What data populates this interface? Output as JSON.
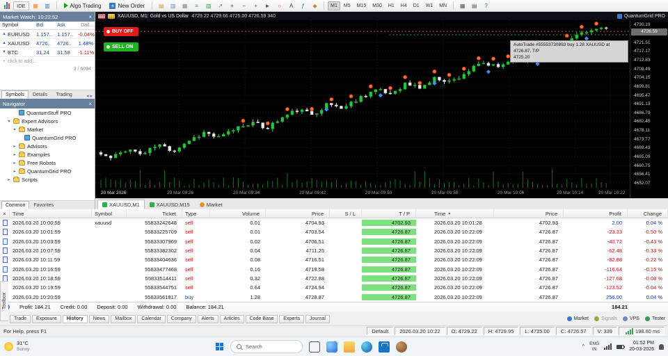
{
  "toolbar": {
    "ide": "IDE",
    "algo_trading": "Algo Trading",
    "new_order": "New Order",
    "timeframes": [
      "M1",
      "M5",
      "M15",
      "M30",
      "H1",
      "H4",
      "D1",
      "W1",
      "MN"
    ],
    "active_timeframe": "M1"
  },
  "market_watch": {
    "title": "Market Watch: 10:22:52",
    "columns": [
      "Symbol",
      "Bid",
      "Ask",
      "Dail..."
    ],
    "rows": [
      {
        "symbol": "EURUSD",
        "bid": "1.157..",
        "ask": "1.157..",
        "daily": "-0.04%",
        "dir": "up",
        "daily_color": "neg"
      },
      {
        "symbol": "XAUUSD",
        "bid": "4726..",
        "ask": "4726..",
        "daily": "1.48%",
        "dir": "up",
        "daily_color": "pos"
      },
      {
        "symbol": "BTC",
        "bid": "31.24",
        "ask": "31.58",
        "daily": "-1.11%",
        "dir": "down",
        "daily_color": "neg"
      }
    ],
    "add_hint": "click to add...",
    "count": "3 / 6094",
    "tabs": [
      "Symbols",
      "Details",
      "Trading"
    ],
    "active_tab": "Symbols"
  },
  "navigator": {
    "title": "Navigator",
    "tree": [
      {
        "label": "QuantumStuff PRO",
        "indent": 2,
        "icon": "ea",
        "arrow": ""
      },
      {
        "label": "Expert Advisors",
        "indent": 1,
        "icon": "folder",
        "arrow": "down"
      },
      {
        "label": "Market",
        "indent": 2,
        "icon": "folder",
        "arrow": "down"
      },
      {
        "label": "QuantumGrid PRO",
        "indent": 3,
        "icon": "ea",
        "arrow": ""
      },
      {
        "label": "Advisors",
        "indent": 2,
        "icon": "folder",
        "arrow": "right"
      },
      {
        "label": "Examples",
        "indent": 2,
        "icon": "folder",
        "arrow": "right"
      },
      {
        "label": "Free Robots",
        "indent": 2,
        "icon": "folder",
        "arrow": "right"
      },
      {
        "label": "QuantumGrid PRO",
        "indent": 2,
        "icon": "folder",
        "arrow": "right"
      },
      {
        "label": "Scripts",
        "indent": 1,
        "icon": "folder",
        "arrow": "right"
      }
    ],
    "tabs": [
      "Common",
      "Favorites"
    ],
    "active_tab": "Common"
  },
  "chart": {
    "title": "XAUUSD, M1: Gold vs US Dollar",
    "ohlcv": "4729.22 4729.66 4725.00 4726.59 340",
    "ea_label": "QuantumGrid PRO",
    "buy_button": "BUY OFF",
    "sell_button": "SELL ON",
    "tooltip_line1": "AutoTrade #55553730893 buy 1.28 XAUUSD at 4726.87, T/P",
    "tooltip_line2": "4725.20",
    "current_price": "4726.59",
    "tabs": [
      "XAUUSD,M1",
      "XAUUSD,M15",
      "Market"
    ],
    "active_tab": "XAUUSD,M1"
  },
  "chart_data": {
    "type": "candlestick",
    "symbol": "XAUUSD",
    "timeframe": "M1",
    "price_top": 4732.4,
    "price_bottom": 4649.3,
    "count": 105,
    "anchors": [
      4667,
      4664,
      4669,
      4666,
      4671,
      4668,
      4673,
      4677,
      4674,
      4679,
      4682,
      4679,
      4684,
      4688,
      4686,
      4691,
      4689,
      4694,
      4698,
      4696,
      4701,
      4699,
      4704,
      4702,
      4707,
      4711,
      4709,
      4714,
      4712,
      4717,
      4720,
      4724,
      4727,
      4729.5
    ],
    "sell_marker_indices": [
      30,
      35,
      39,
      44,
      48,
      52,
      56,
      60,
      63,
      66,
      69,
      72,
      75,
      78,
      81,
      84,
      87,
      90,
      93,
      96,
      99,
      102
    ],
    "diamond_marker_indices": [
      47,
      58,
      69,
      80,
      90,
      100
    ],
    "trade_lines": [
      {
        "price": 4726.87,
        "color": "#cc5555",
        "from": 0
      },
      {
        "price": 4725.2,
        "color": "#33aa33",
        "from": 0.55
      }
    ],
    "price_labels": [
      "4730.19",
      "4725.85",
      "4721.51",
      "4717.17",
      "4712.83",
      "4708.49",
      "4704.15",
      "4699.81",
      "4695.47",
      "4691.13",
      "4686.79",
      "4682.45",
      "4678.11",
      "4673.77",
      "4669.43",
      "4665.09",
      "4660.75",
      "4656.41",
      "4652.07"
    ],
    "time_labels": [
      "20 Mar 2026",
      "20 Mar 09:26",
      "20 Mar 09:34",
      "20 Mar 09:42",
      "20 Mar 09:50",
      "20 Mar 09:58",
      "20 Mar 10:06",
      "20 Mar 10:14",
      "20 Mar 10:22"
    ]
  },
  "history": {
    "columns": [
      "Time",
      "Symbol",
      "Ticket",
      "Type",
      "Volume",
      "Price",
      "S / L",
      "T / P",
      "Time",
      "Price",
      "Profit",
      "Change"
    ],
    "rows": [
      [
        "2026.03.20 10:00:59",
        "xauusd",
        "55833242648",
        "sell",
        "0.01",
        "4704.93",
        "",
        "4702.93",
        "2026.03.20 10:01:28",
        "4702.93",
        "2.00",
        "0.04 %"
      ],
      [
        "2026.03.20 10:01:59",
        "",
        "55833225709",
        "sell",
        "0.01",
        "4703.54",
        "",
        "4726.87",
        "2026.03.20 10:22:09",
        "4726.87",
        "-23.33",
        "-0.50 %"
      ],
      [
        "2026.03.20 10:03:59",
        "",
        "55833307969",
        "sell",
        "0.02",
        "4706.51",
        "",
        "4726.87",
        "2026.03.20 10:22:09",
        "4726.87",
        "-40.72",
        "-0.43 %"
      ],
      [
        "2026.03.20 10:07:59",
        "",
        "55833382302",
        "sell",
        "0.04",
        "4711.25",
        "",
        "4726.87",
        "2026.03.20 10:22:09",
        "4726.87",
        "-62.48",
        "-0.33 %"
      ],
      [
        "2026.03.20 10:11:59",
        "",
        "55833404636",
        "sell",
        "0.08",
        "4716.51",
        "",
        "4726.87",
        "2026.03.20 10:22:09",
        "4726.87",
        "-82.88",
        "-0.22 %"
      ],
      [
        "2026.03.20 10:16:59",
        "",
        "55833477468",
        "sell",
        "0.16",
        "4719.58",
        "",
        "4726.87",
        "2026.03.20 10:22:09",
        "4726.87",
        "-116.64",
        "-0.15 %"
      ],
      [
        "2026.03.20 10:18:59",
        "",
        "55833514411",
        "sell",
        "0.32",
        "4722.88",
        "",
        "4726.87",
        "2026.03.20 10:22:09",
        "4726.87",
        "-127.68",
        "-0.08 %"
      ],
      [
        "2026.03.20 10:19:59",
        "",
        "55833544751",
        "sell",
        "0.64",
        "4724.94",
        "",
        "4726.87",
        "2026.03.20 10:22:09",
        "4726.87",
        "-123.52",
        "-0.04 %"
      ],
      [
        "2026.03.20 10:20:59",
        "",
        "55833561817",
        "buy",
        "1.28",
        "4728.87",
        "",
        "4726.87",
        "2026.03.20 10:22:09",
        "4726.87",
        "256.00",
        "0.04 %"
      ]
    ],
    "summary_items": [
      "Profit: 184.21",
      "Credit: 0.00",
      "Deposit: 0.00",
      "Withdrawal: 0.00",
      "Balance: 184.21"
    ],
    "summary_total": "184.21"
  },
  "toolbox": {
    "vertical_label": "Toolbox",
    "tabs": [
      "Trade",
      "Exposure",
      "History",
      "News",
      "Mailbox",
      "Calendar",
      "Company",
      "Alerts",
      "Articles",
      "Code Base",
      "Experts",
      "Journal"
    ],
    "active_tab": "History",
    "right_items": [
      {
        "label": "Market",
        "muted": false
      },
      {
        "label": "Signals",
        "muted": true
      },
      {
        "label": "VPS",
        "muted": false
      },
      {
        "label": "Tester",
        "muted": false
      }
    ]
  },
  "statusbar": {
    "help": "For Help, press F1",
    "segments": [
      "Default",
      "2026.03.20 10:22",
      "O: 4729.22",
      "H: 4729.95",
      "L: 4725.00",
      "C: 4726.57",
      "V: 339"
    ],
    "latency": "198.60 ms"
  },
  "taskbar": {
    "weather_temp": "31°C",
    "weather_desc": "Sunny",
    "search_placeholder": "Search",
    "lang_line1": "ENG",
    "lang_line2": "IN",
    "time": "01:52 PM",
    "date": "20-03-2026"
  }
}
